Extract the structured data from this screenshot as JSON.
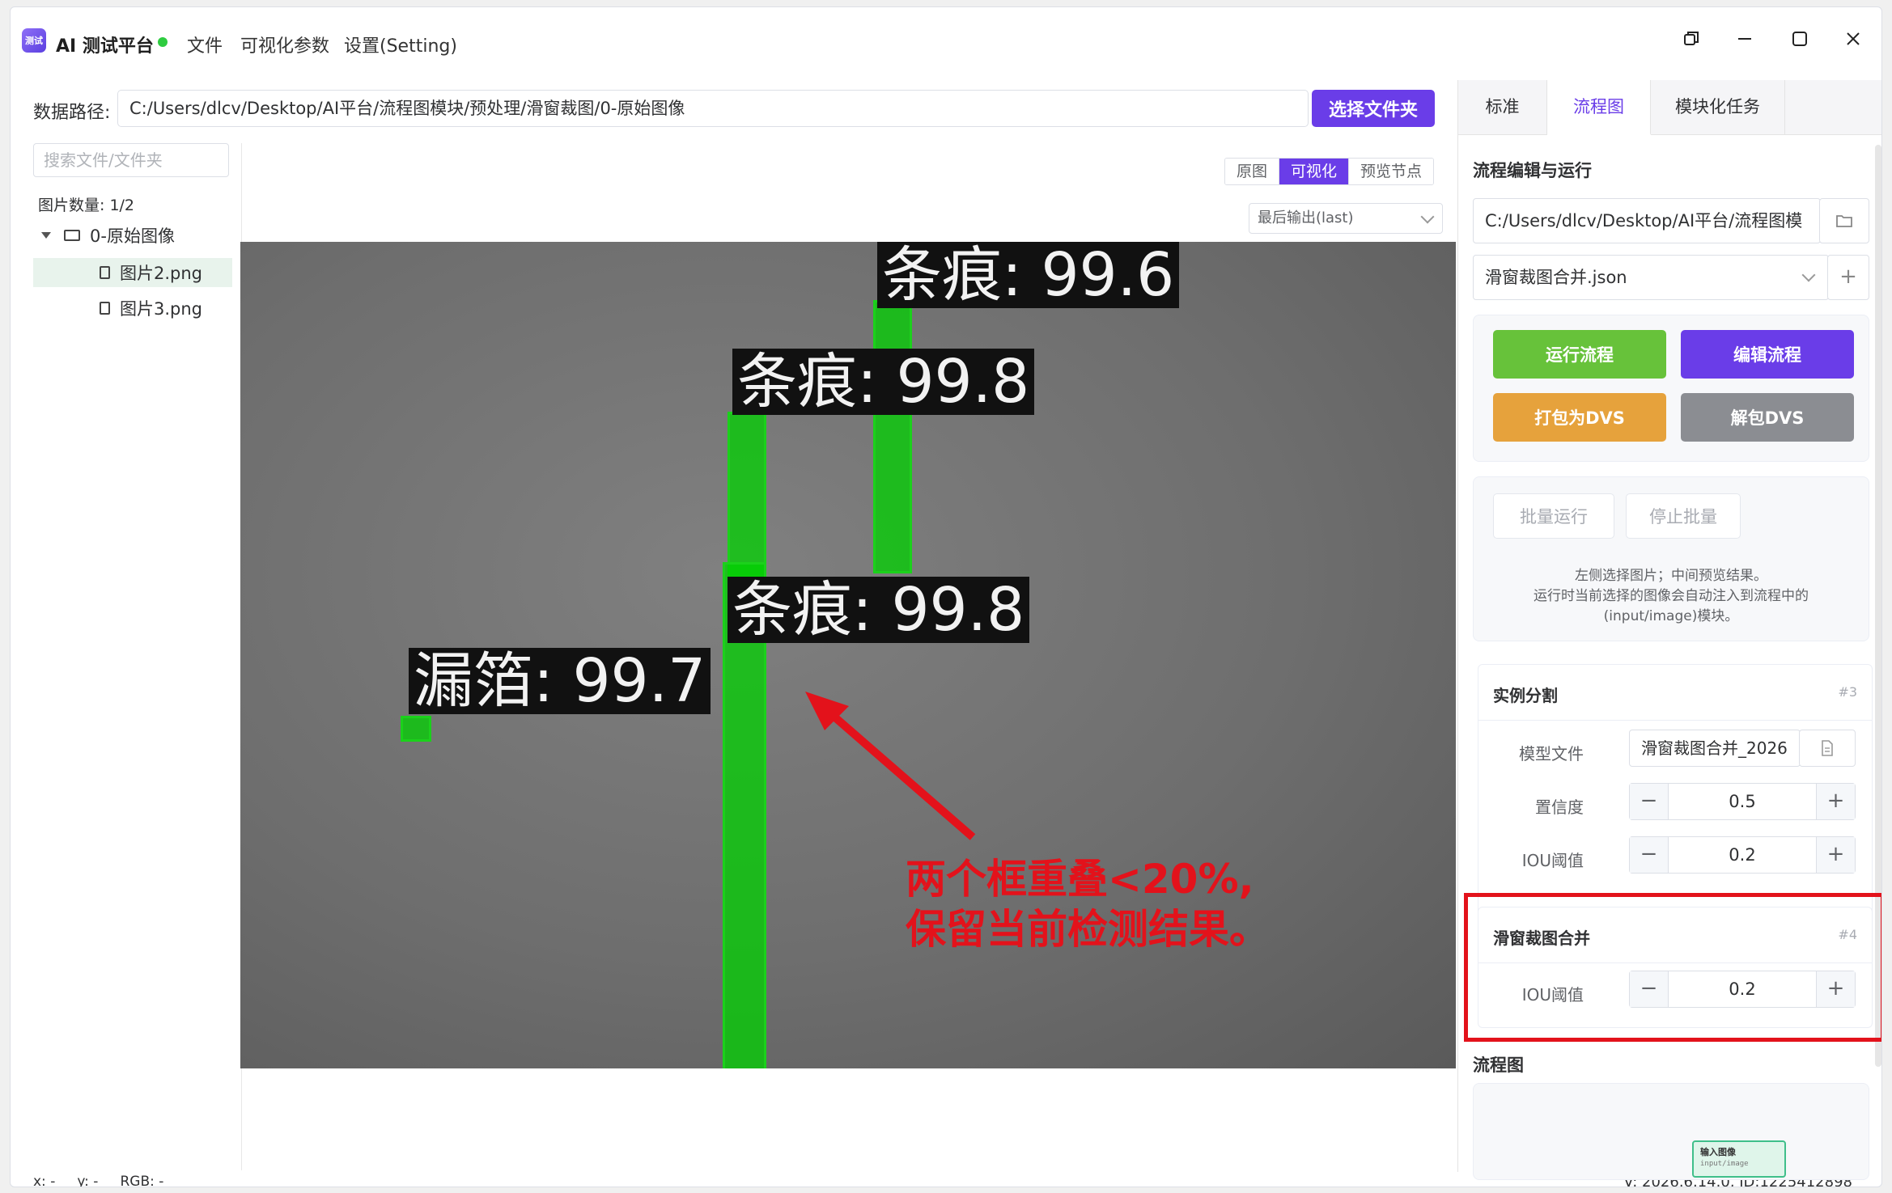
{
  "app": {
    "logo_text": "测试",
    "title": "AI 测试平台",
    "menu": [
      "文件",
      "可视化参数",
      "设置(Setting)"
    ],
    "window_controls": [
      "restore-icon",
      "minimize-icon",
      "maximize-icon",
      "close-icon"
    ]
  },
  "path_bar": {
    "label": "数据路径:",
    "value": "C:/Users/dlcv/Desktop/AI平台/流程图模块/预处理/滑窗裁图/0-原始图像",
    "choose_button": "选择文件夹"
  },
  "file_panel": {
    "search_placeholder": "搜索文件/文件夹",
    "count": "图片数量:  1/2",
    "folder": "0-原始图像",
    "files": [
      {
        "name": "图片2.png",
        "selected": true
      },
      {
        "name": "图片3.png",
        "selected": false
      }
    ]
  },
  "preview": {
    "tabs": [
      "原图",
      "可视化",
      "预览节点"
    ],
    "active_tab": "可视化",
    "output_select": "最后输出(last)",
    "detections": [
      {
        "label": "条痕: 99.6"
      },
      {
        "label": "条痕: 99.8"
      },
      {
        "label": "条痕: 99.8"
      },
      {
        "label": "漏箔: 99.7"
      }
    ],
    "annotation_line1": "两个框重叠<20%,",
    "annotation_line2": "保留当前检测结果。",
    "colors": {
      "box": "#1bd11b",
      "annotation": "#e3121b"
    }
  },
  "status": {
    "left": "x: -     y: -     RGB: -",
    "right": "V: 2026.6.14.0, ID:1225412898"
  },
  "right_panel": {
    "tabs": [
      "标准",
      "流程图",
      "模块化任务"
    ],
    "active_tab": "流程图",
    "section_title": "流程编辑与运行",
    "flow_path": "C:/Users/dlcv/Desktop/AI平台/流程图模",
    "flow_file": "滑窗裁图合并.json",
    "buttons": {
      "run": "运行流程",
      "edit": "编辑流程",
      "pack": "打包为DVS",
      "unpack": "解包DVS",
      "batch_run": "批量运行",
      "stop_batch": "停止批量"
    },
    "hint_lines": [
      "左侧选择图片；中间预览结果。",
      "运行时当前选择的图像会自动注入到流程中的",
      "(input/image)模块。"
    ],
    "module1": {
      "title": "实例分割",
      "id": "#3",
      "model_label": "模型文件",
      "model_value": "滑窗裁图合并_2026",
      "conf_label": "置信度",
      "conf_value": "0.5",
      "iou_label": "IOU阈值",
      "iou_value": "0.2"
    },
    "module2": {
      "title": "滑窗裁图合并",
      "id": "#4",
      "iou_label": "IOU阈值",
      "iou_value": "0.2"
    },
    "flow_title": "流程图",
    "flow_node": {
      "title": "输入图像",
      "subtitle": "input/image"
    },
    "accent": "#6a3de8"
  }
}
